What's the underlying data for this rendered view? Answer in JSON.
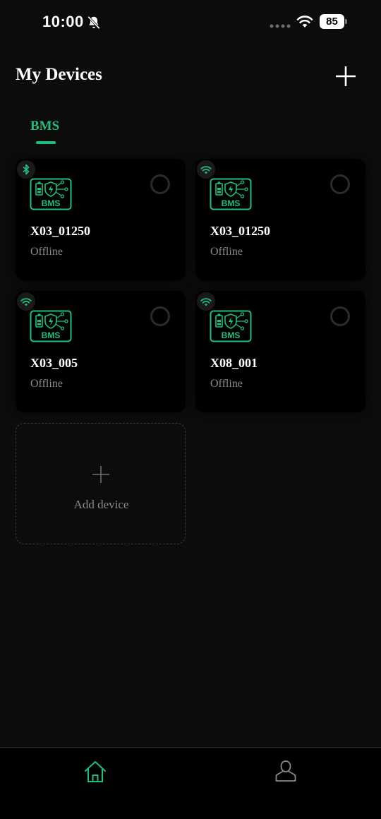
{
  "status_bar": {
    "time": "10:00",
    "battery": "85",
    "icons": [
      "bell-slash-icon",
      "signal-dots-icon",
      "wifi-icon",
      "battery-icon"
    ]
  },
  "header": {
    "title": "My Devices",
    "add_icon": "plus-icon"
  },
  "tabs": [
    {
      "label": "BMS",
      "active": true
    }
  ],
  "devices": [
    {
      "name": "X03_01250",
      "status": "Offline",
      "connection": "bluetooth-icon"
    },
    {
      "name": "X03_01250",
      "status": "Offline",
      "connection": "wifi-icon"
    },
    {
      "name": "X03_005",
      "status": "Offline",
      "connection": "wifi-icon"
    },
    {
      "name": "X08_001",
      "status": "Offline",
      "connection": "wifi-icon"
    }
  ],
  "device_icon_text": "BMS",
  "add_device": {
    "label": "Add device"
  },
  "bottom_nav": [
    {
      "icon": "home-icon",
      "active": true
    },
    {
      "icon": "profile-icon",
      "active": false
    }
  ],
  "colors": {
    "accent": "#1fbf7e",
    "background": "#0c0c0c",
    "card": "#000000",
    "muted_text": "#8a8a8a"
  }
}
